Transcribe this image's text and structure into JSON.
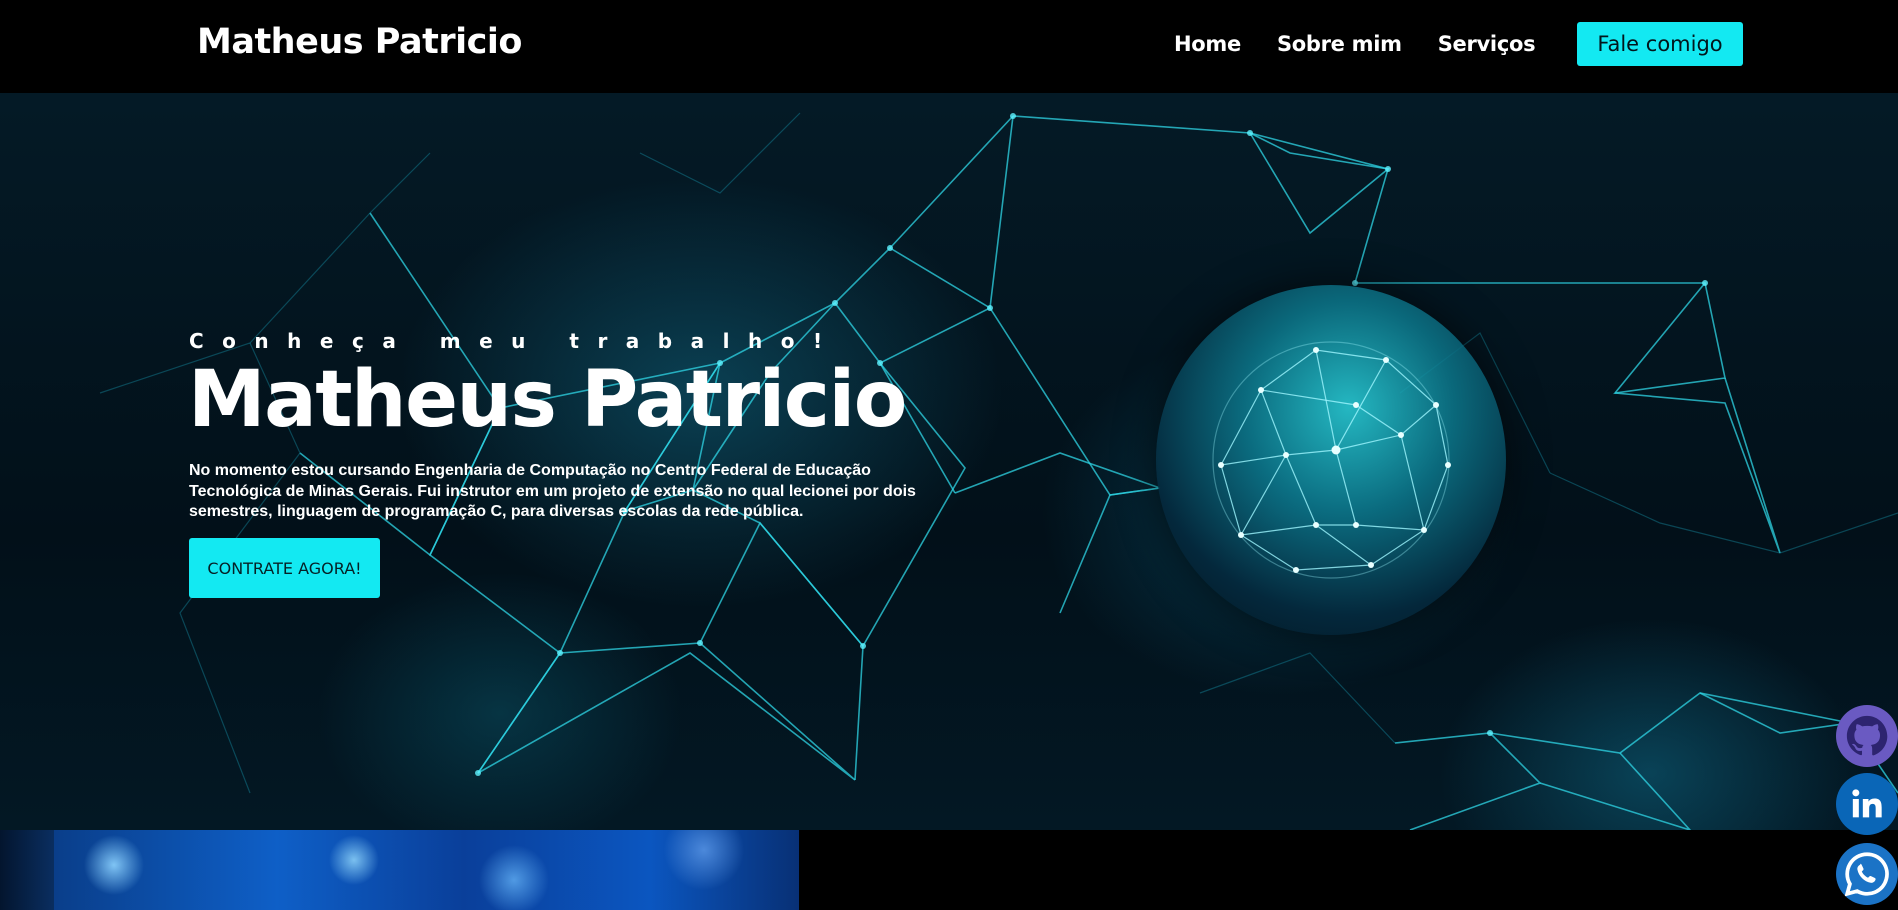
{
  "header": {
    "brand": "Matheus Patricio",
    "nav": [
      "Home",
      "Sobre mim",
      "Serviços"
    ],
    "cta": "Fale comigo"
  },
  "hero": {
    "eyebrow": "Conheça meu trabalho!",
    "title": "Matheus Patricio",
    "text": "No momento estou cursando Engenharia de Computação no Centro Federal de Educação Tecnológica de Minas Gerais. Fui instrutor em um projeto de extensão no qual lecionei por dois semestres, linguagem de programação C, para diversas escolas da rede pública.",
    "button": "CONTRATE AGORA!"
  },
  "social": {
    "icons": [
      "github-icon",
      "linkedin-icon",
      "whatsapp-icon"
    ]
  },
  "colors": {
    "accent": "#13e9f2",
    "header_bg": "#000000",
    "hero_bg": "#021019"
  }
}
